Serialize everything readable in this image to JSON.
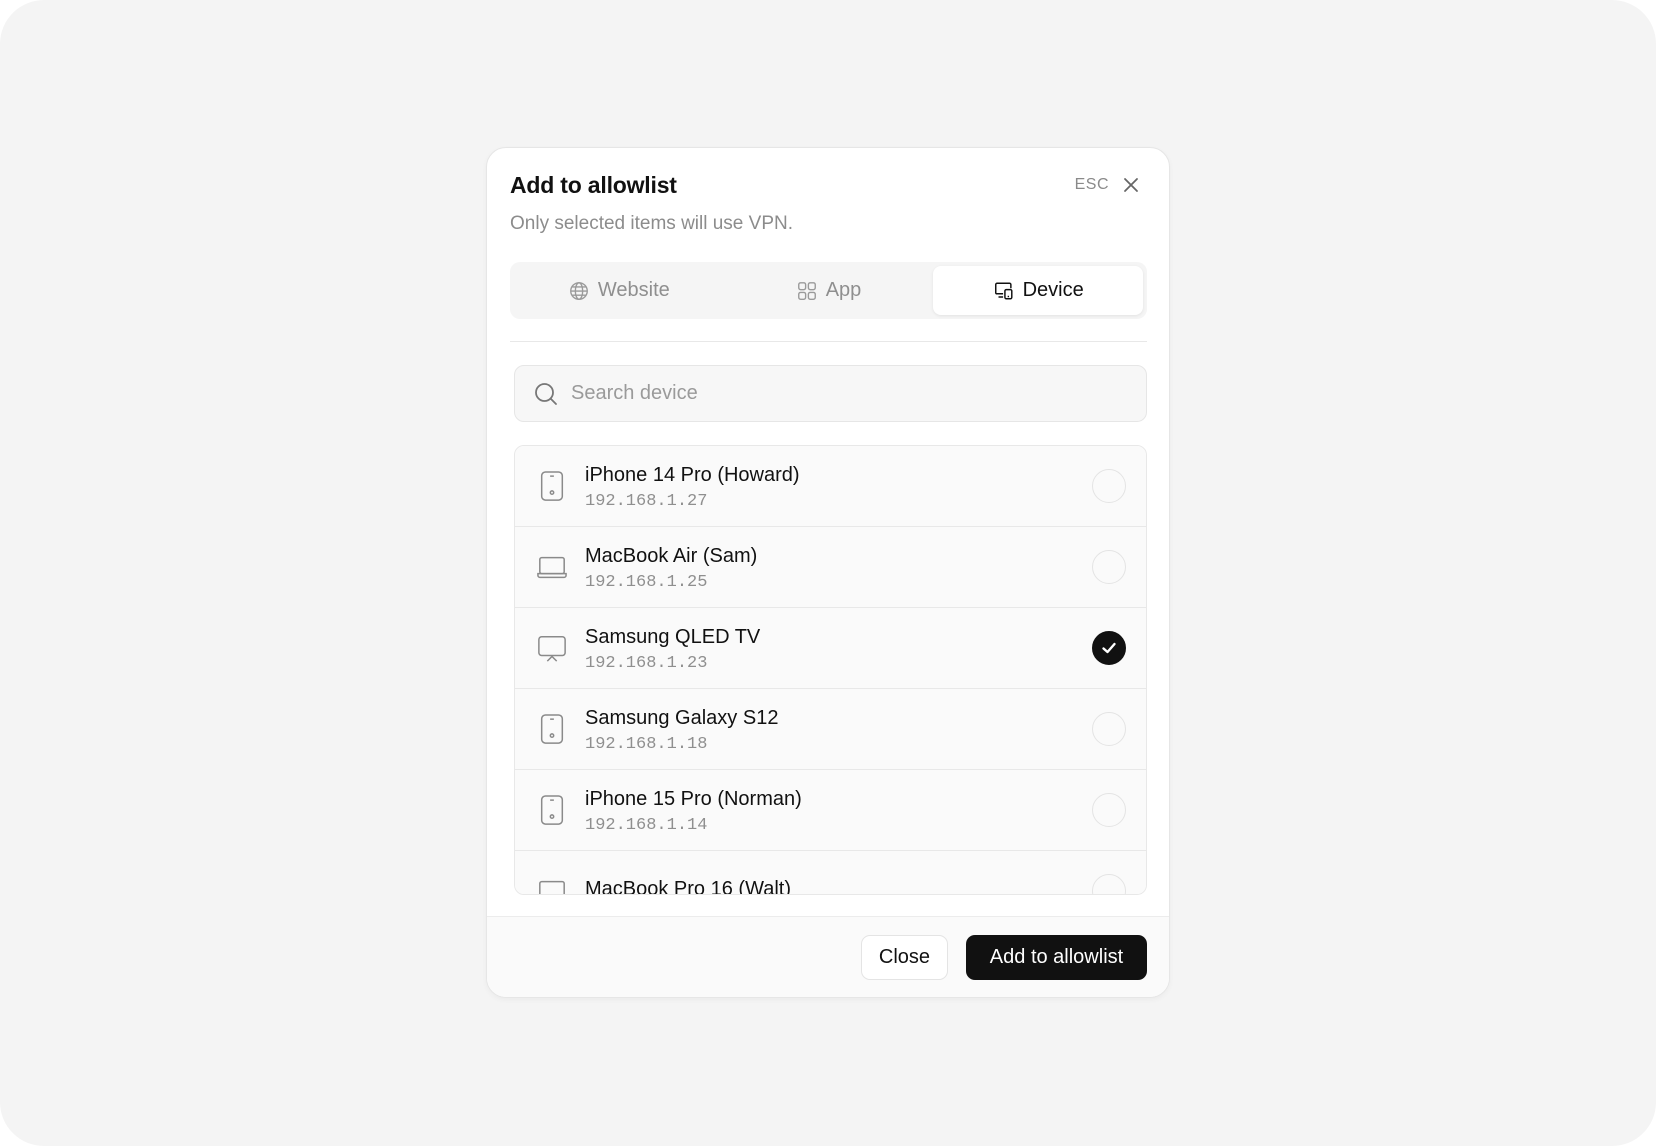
{
  "dialog": {
    "title": "Add to allowlist",
    "subtitle": "Only selected items will use VPN.",
    "esc_label": "ESC"
  },
  "tabs": [
    {
      "label": "Website",
      "icon": "globe-icon",
      "active": false
    },
    {
      "label": "App",
      "icon": "grid-icon",
      "active": false
    },
    {
      "label": "Device",
      "icon": "devices-icon",
      "active": true
    }
  ],
  "search": {
    "placeholder": "Search device",
    "value": ""
  },
  "devices": [
    {
      "name": "iPhone 14 Pro (Howard)",
      "ip": "192.168.1.27",
      "icon": "phone-icon",
      "selected": false
    },
    {
      "name": "MacBook Air (Sam)",
      "ip": "192.168.1.25",
      "icon": "laptop-icon",
      "selected": false
    },
    {
      "name": "Samsung QLED TV",
      "ip": "192.168.1.23",
      "icon": "tv-icon",
      "selected": true
    },
    {
      "name": "Samsung Galaxy S12",
      "ip": "192.168.1.18",
      "icon": "phone-icon",
      "selected": false
    },
    {
      "name": "iPhone 15 Pro (Norman)",
      "ip": "192.168.1.14",
      "icon": "phone-icon",
      "selected": false
    },
    {
      "name": "MacBook Pro 16 (Walt)",
      "ip": "",
      "icon": "laptop-icon",
      "selected": false
    }
  ],
  "footer": {
    "close_label": "Close",
    "add_label": "Add to allowlist"
  },
  "colors": {
    "primary": "#111111",
    "muted_text": "#8f8f8f",
    "background": "#f4f4f4",
    "surface": "#ffffff"
  }
}
